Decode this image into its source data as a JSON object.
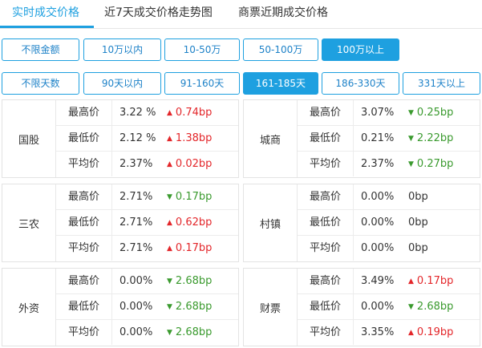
{
  "tabs": [
    {
      "label": "实时成交价格",
      "active": true
    },
    {
      "label": "近7天成交价格走势图",
      "active": false
    },
    {
      "label": "商票近期成交价格",
      "active": false
    }
  ],
  "amount_filters": [
    {
      "label": "不限金额",
      "active": false
    },
    {
      "label": "10万以内",
      "active": false
    },
    {
      "label": "10-50万",
      "active": false
    },
    {
      "label": "50-100万",
      "active": false
    },
    {
      "label": "100万以上",
      "active": true
    }
  ],
  "day_filters": [
    {
      "label": "不限天数",
      "active": false
    },
    {
      "label": "90天以内",
      "active": false
    },
    {
      "label": "91-160天",
      "active": false
    },
    {
      "label": "161-185天",
      "active": true
    },
    {
      "label": "186-330天",
      "active": false
    },
    {
      "label": "331天以上",
      "active": false
    }
  ],
  "colors": {
    "accent": "#1ea0e0",
    "up": "#e3262a",
    "down": "#3a9a2e"
  },
  "panels": [
    {
      "name": "国股",
      "rows": [
        {
          "label": "最高价",
          "value": "3.22 %",
          "direction": "up",
          "change": "0.74bp"
        },
        {
          "label": "最低价",
          "value": "2.12 %",
          "direction": "up",
          "change": "1.38bp"
        },
        {
          "label": "平均价",
          "value": "2.37%",
          "direction": "up",
          "change": "0.02bp"
        }
      ]
    },
    {
      "name": "城商",
      "rows": [
        {
          "label": "最高价",
          "value": "3.07%",
          "direction": "down",
          "change": "0.25bp"
        },
        {
          "label": "最低价",
          "value": "0.21%",
          "direction": "down",
          "change": "2.22bp"
        },
        {
          "label": "平均价",
          "value": "2.37%",
          "direction": "down",
          "change": "0.27bp"
        }
      ]
    },
    {
      "name": "三农",
      "rows": [
        {
          "label": "最高价",
          "value": "2.71%",
          "direction": "down",
          "change": "0.17bp"
        },
        {
          "label": "最低价",
          "value": "2.71%",
          "direction": "up",
          "change": "0.62bp"
        },
        {
          "label": "平均价",
          "value": "2.71%",
          "direction": "up",
          "change": "0.17bp"
        }
      ]
    },
    {
      "name": "村镇",
      "rows": [
        {
          "label": "最高价",
          "value": "0.00%",
          "direction": "flat",
          "change": "0bp"
        },
        {
          "label": "最低价",
          "value": "0.00%",
          "direction": "flat",
          "change": "0bp"
        },
        {
          "label": "平均价",
          "value": "0.00%",
          "direction": "flat",
          "change": "0bp"
        }
      ]
    },
    {
      "name": "外资",
      "rows": [
        {
          "label": "最高价",
          "value": "0.00%",
          "direction": "down",
          "change": "2.68bp"
        },
        {
          "label": "最低价",
          "value": "0.00%",
          "direction": "down",
          "change": "2.68bp"
        },
        {
          "label": "平均价",
          "value": "0.00%",
          "direction": "down",
          "change": "2.68bp"
        }
      ]
    },
    {
      "name": "财票",
      "rows": [
        {
          "label": "最高价",
          "value": "3.49%",
          "direction": "up",
          "change": "0.17bp"
        },
        {
          "label": "最低价",
          "value": "0.00%",
          "direction": "down",
          "change": "2.68bp"
        },
        {
          "label": "平均价",
          "value": "3.35%",
          "direction": "up",
          "change": "0.19bp"
        }
      ]
    }
  ]
}
